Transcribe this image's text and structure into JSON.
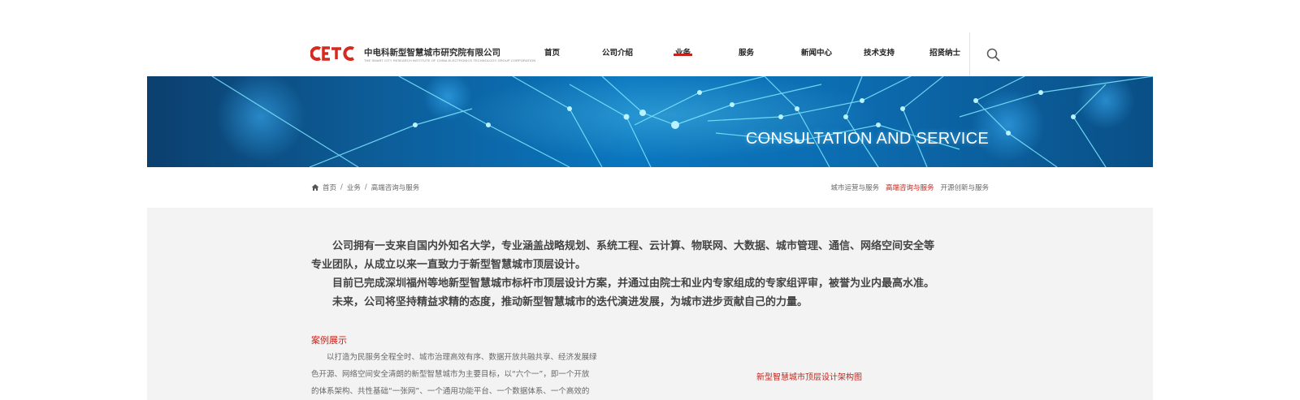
{
  "header": {
    "logo_mark": "CETC",
    "company_name_cn": "中电科新型智慧城市研究院有限公司",
    "company_name_en": "THE SMART CITY RESEARCH INSTITUTE OF CHINA ELECTRONICS TECHNOLOGY GROUP CORPORATION",
    "nav": [
      {
        "label": "首页"
      },
      {
        "label": "公司介绍"
      },
      {
        "label": "业务"
      },
      {
        "label": "服务"
      },
      {
        "label": "新闻中心"
      },
      {
        "label": "技术支持"
      },
      {
        "label": "招贤纳士"
      }
    ],
    "active_nav": "业务",
    "search_icon": "search-icon"
  },
  "banner": {
    "title": "CONSULTATION AND SERVICE"
  },
  "breadcrumb": {
    "home_icon": "home-icon",
    "items": [
      "首页",
      "业务",
      "高端咨询与服务"
    ],
    "separator": "/"
  },
  "subnav": {
    "items": [
      "城市运营与服务",
      "高端咨询与服务",
      "开源创新与服务"
    ],
    "active": "高端咨询与服务"
  },
  "main": {
    "intro_lines": [
      "公司拥有一支来自国内外知名大学，专业涵盖战略规划、系统工程、云计算、物联网、大数据、城市管理、通信、网络空间安全等",
      "专业团队，从成立以来一直致力于新型智慧城市顶层设计。",
      "目前已完成深圳福州等地新型智慧城市标杆市顶层设计方案，并通过由院士和业内专家组成的专家组评审，被誉为业内最高水准。",
      "未来，公司将坚持精益求精的态度，推动新型智慧城市的迭代演进发展，为城市进步贡献自己的力量。"
    ],
    "case_title": "案例展示",
    "case_lines": [
      "以打造为民服务全程全时、城市治理高效有序、数据开放共融共享、经济发展绿",
      "色开源、网络空间安全清朗的新型智慧城市为主要目标，以“六个一”，即一个开放",
      "的体系架构、共性基础“一张网”、一个通用功能平台、一个数据体系、一个高效的"
    ],
    "diagram_caption": "新型智慧城市顶层设计架构图"
  },
  "colors": {
    "accent_red": "#c4241c",
    "banner_blue": "#0a76bf",
    "content_bg": "#f3f3f3"
  }
}
